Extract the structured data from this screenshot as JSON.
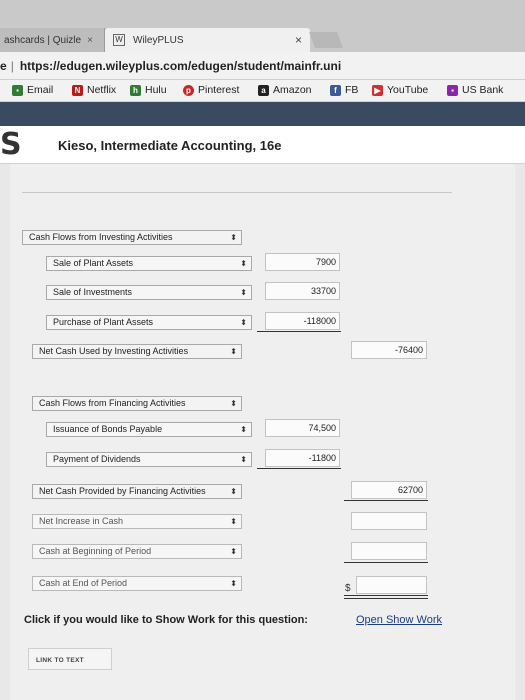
{
  "browser": {
    "tabs": [
      {
        "label": "ashcards | Quizle",
        "close": "×"
      },
      {
        "label": "WileyPLUS",
        "close": "×"
      }
    ],
    "address": {
      "prefix": "e",
      "url": "https://edugen.wileyplus.com/edugen/student/mainfr.uni"
    },
    "bookmarks": [
      {
        "label": "Email",
        "icon": "email-icon",
        "color": "#2e7d32"
      },
      {
        "label": "Netflix",
        "icon": "netflix-icon",
        "color": "#b71c1c"
      },
      {
        "label": "Hulu",
        "icon": "hulu-icon",
        "color": "#2e7d32"
      },
      {
        "label": "Pinterest",
        "icon": "pinterest-icon",
        "color": "#c62828"
      },
      {
        "label": "Amazon",
        "icon": "amazon-icon",
        "color": "#222222"
      },
      {
        "label": "FB",
        "icon": "facebook-icon",
        "color": "#3b5998"
      },
      {
        "label": "YouTube",
        "icon": "youtube-icon",
        "color": "#d32f2f"
      },
      {
        "label": "US Bank",
        "icon": "usbank-icon",
        "color": "#8e24aa"
      }
    ]
  },
  "app": {
    "logo": "S",
    "book_title": "Kieso, Intermediate Accounting, 16e"
  },
  "worksheet": {
    "investing": {
      "header": "Cash Flows from Investing Activities",
      "rows": [
        {
          "label": "Sale of Plant Assets",
          "value": "7900"
        },
        {
          "label": "Sale of Investments",
          "value": "33700"
        },
        {
          "label": "Purchase of Plant Assets",
          "value": "-118000"
        }
      ],
      "total_label": "Net Cash Used by Investing Activities",
      "total_value": "-76400"
    },
    "financing": {
      "header": "Cash Flows from Financing Activities",
      "rows": [
        {
          "label": "Issuance of Bonds Payable",
          "value": "74,500"
        },
        {
          "label": "Payment of Dividends",
          "value": "-11800"
        }
      ],
      "total_label": "Net Cash Provided by Financing Activities",
      "total_value": "62700"
    },
    "net_increase_label": "Net Increase in Cash",
    "beginning_label": "Cash at Beginning of Period",
    "end_label": "Cash at End of Period",
    "dollar_sign": "$"
  },
  "footer": {
    "show_work_question": "Click if you would like to Show Work for this question:",
    "show_work_link": "Open Show Work",
    "link_to_text": "LINK TO TEXT"
  }
}
